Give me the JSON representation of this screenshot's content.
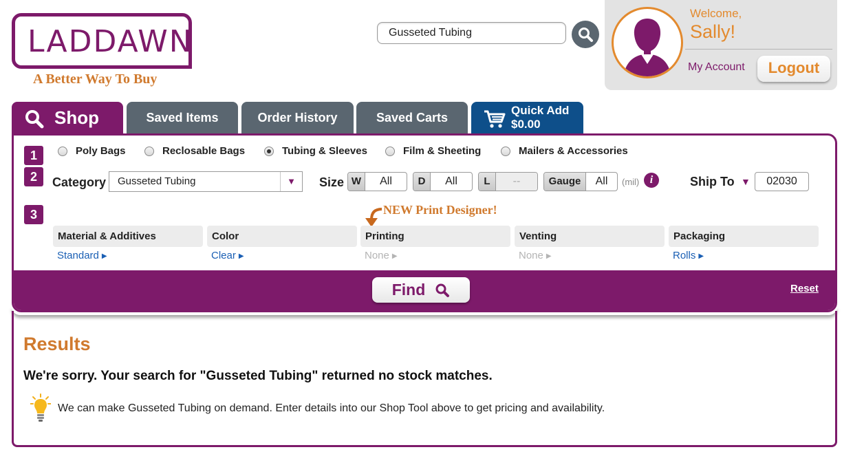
{
  "brand": {
    "logo_text": "LADDAWN",
    "tagline": "A Better Way To Buy",
    "primary_color": "#7d1a6a",
    "accent_color": "#e38a2e"
  },
  "search": {
    "value": "Gusseted Tubing"
  },
  "account": {
    "welcome": "Welcome,",
    "name": "Sally!",
    "my_account": "My Account",
    "logout": "Logout"
  },
  "tabs": {
    "shop": "Shop",
    "saved_items": "Saved Items",
    "order_history": "Order History",
    "saved_carts": "Saved Carts",
    "quick_add_label": "Quick Add",
    "quick_add_total": "$0.00"
  },
  "steps": [
    "1",
    "2",
    "3"
  ],
  "product_types": [
    {
      "label": "Poly Bags",
      "selected": false
    },
    {
      "label": "Reclosable Bags",
      "selected": false
    },
    {
      "label": "Tubing & Sleeves",
      "selected": true
    },
    {
      "label": "Film & Sheeting",
      "selected": false
    },
    {
      "label": "Mailers & Accessories",
      "selected": false
    }
  ],
  "filters": {
    "category_label": "Category",
    "category_value": "Gusseted Tubing",
    "size_label": "Size",
    "width": {
      "tag": "W",
      "value": "All"
    },
    "depth": {
      "tag": "D",
      "value": "All"
    },
    "length": {
      "tag": "L",
      "value": "--"
    },
    "gauge": {
      "tag": "Gauge",
      "value": "All"
    },
    "gauge_unit": "(mil)",
    "info_icon": "i",
    "ship_to_label": "Ship To",
    "ship_to_zip": "02030"
  },
  "print_designer_note": "NEW Print Designer!",
  "options": [
    {
      "header": "Material & Additives",
      "value": "Standard",
      "enabled": true
    },
    {
      "header": "Color",
      "value": "Clear",
      "enabled": true
    },
    {
      "header": "Printing",
      "value": "None",
      "enabled": false
    },
    {
      "header": "Venting",
      "value": "None",
      "enabled": false
    },
    {
      "header": "Packaging",
      "value": "Rolls",
      "enabled": true
    }
  ],
  "find_label": "Find",
  "reset_label": "Reset",
  "results": {
    "title": "Results",
    "sorry": "We're sorry. Your search for \"Gusseted Tubing\" returned no stock matches.",
    "note": "We can make Gusseted Tubing on demand. Enter details into our Shop Tool above to get pricing and availability."
  }
}
